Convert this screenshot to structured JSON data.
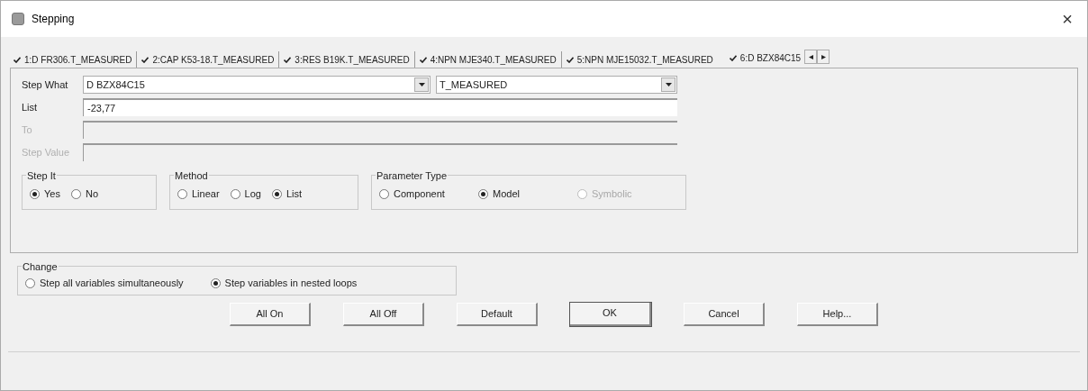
{
  "window": {
    "title": "Stepping",
    "close": "×"
  },
  "tabs": [
    {
      "label": "1:D FR306.T_MEASURED",
      "checked": true,
      "selected": false
    },
    {
      "label": "2:CAP K53-18.T_MEASURED",
      "checked": true,
      "selected": false
    },
    {
      "label": "3:RES B19K.T_MEASURED",
      "checked": true,
      "selected": false
    },
    {
      "label": "4:NPN MJE340.T_MEASURED",
      "checked": true,
      "selected": false
    },
    {
      "label": "5:NPN MJE15032.T_MEASURED",
      "checked": true,
      "selected": false
    },
    {
      "label": "6:D BZX84C15",
      "checked": true,
      "selected": true
    }
  ],
  "tab_scroll": [
    "◂",
    "▸"
  ],
  "step_what": {
    "label": "Step What",
    "device": "D BZX84C15",
    "parameter": "T_MEASURED"
  },
  "fields": [
    {
      "label": "List",
      "value": "-23,77",
      "disabled": false
    },
    {
      "label": "To",
      "disabled": true
    },
    {
      "label": "Step Value",
      "disabled": true
    }
  ],
  "groups": [
    {
      "title": "Step It",
      "options": [
        {
          "label": "Yes",
          "selected": true,
          "disabled": false
        },
        {
          "label": "No",
          "selected": false,
          "disabled": false
        }
      ]
    },
    {
      "title": "Method",
      "options": [
        {
          "label": "Linear",
          "selected": false,
          "disabled": false
        },
        {
          "label": "Log",
          "selected": false,
          "disabled": false
        },
        {
          "label": "List",
          "selected": true,
          "disabled": false
        }
      ]
    },
    {
      "title": "Parameter Type",
      "options": [
        {
          "label": "Component",
          "selected": false,
          "disabled": false
        },
        {
          "label": "Model",
          "selected": true,
          "disabled": false
        },
        {
          "label": "Symbolic",
          "selected": false,
          "disabled": true
        }
      ]
    }
  ],
  "change": {
    "title": "Change",
    "options": [
      {
        "label": "Step all variables simultaneously",
        "selected": false
      },
      {
        "label": "Step variables in nested loops",
        "selected": true
      }
    ]
  },
  "buttons": [
    {
      "label": "All On",
      "default": false
    },
    {
      "label": "All Off",
      "default": false
    },
    {
      "label": "Default",
      "default": false
    },
    {
      "label": "OK",
      "default": true
    },
    {
      "label": "Cancel",
      "default": false
    },
    {
      "label": "Help...",
      "default": false
    }
  ]
}
